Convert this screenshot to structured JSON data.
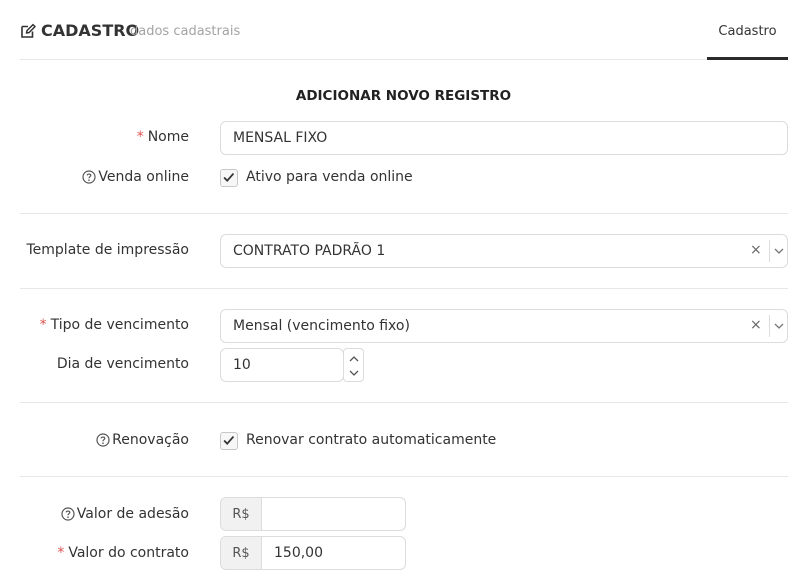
{
  "header": {
    "title": "CADASTRO",
    "subtitle": "dados cadastrais",
    "tab": "Cadastro"
  },
  "section_title": "ADICIONAR NOVO REGISTRO",
  "form": {
    "nome": {
      "label": "Nome",
      "value": "MENSAL FIXO",
      "required": true
    },
    "venda_online": {
      "label": "Venda online",
      "checkbox_label": "Ativo para venda online",
      "checked": true
    },
    "template": {
      "label": "Template de impressão",
      "value": "CONTRATO PADRÃO 1",
      "clear": "×"
    },
    "tipo_vencimento": {
      "label": "Tipo de vencimento",
      "value": "Mensal (vencimento fixo)",
      "required": true,
      "clear": "×"
    },
    "dia_vencimento": {
      "label": "Dia de vencimento",
      "value": "10"
    },
    "renovacao": {
      "label": "Renovação",
      "checkbox_label": "Renovar contrato automaticamente",
      "checked": true
    },
    "valor_adesao": {
      "label": "Valor de adesão",
      "prefix": "R$",
      "value": ""
    },
    "valor_contrato": {
      "label": "Valor do contrato",
      "prefix": "R$",
      "value": "150,00",
      "required": true
    }
  },
  "required_mark": "*",
  "colors": {
    "required": "#d9534f",
    "tab_active_border": "#2a2a2a",
    "border": "#dcdcdc"
  },
  "icons": {
    "edit": "edit-icon",
    "help": "question-circle-icon",
    "check": "check-icon",
    "chevron": "chevron-down-icon"
  }
}
